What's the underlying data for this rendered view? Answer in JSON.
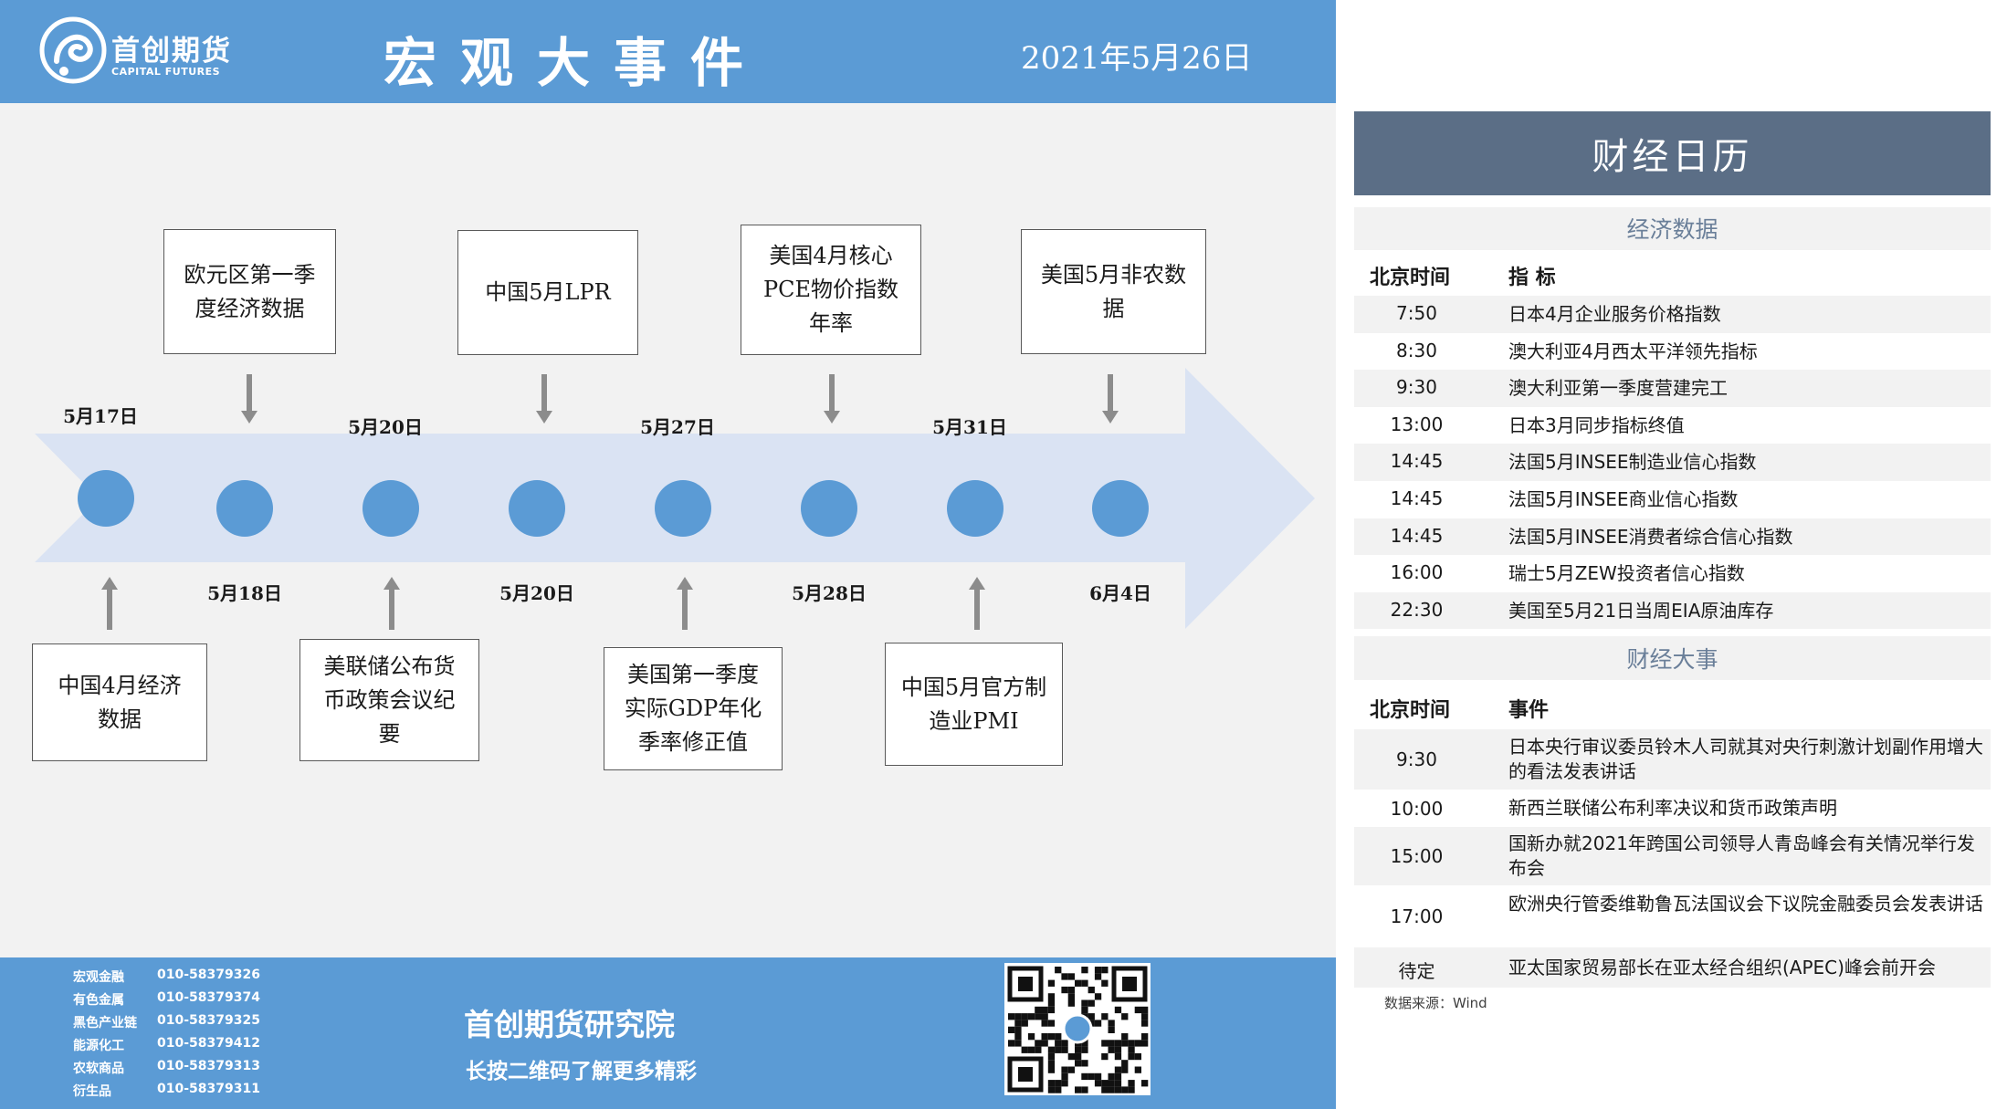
{
  "header": {
    "logo_cn": "首创期货",
    "logo_en": "CAPITAL FUTURES",
    "title": "宏观大事件",
    "date": "2021年5月26日"
  },
  "timeline": {
    "top_dates": [
      "5月17日",
      "5月20日",
      "5月27日",
      "5月31日"
    ],
    "bottom_dates": [
      "5月18日",
      "5月20日",
      "5月28日",
      "6月4日"
    ],
    "top_events": [
      {
        "lines": [
          "欧元区第一季",
          "度经济数据"
        ]
      },
      {
        "lines": [
          "中国5月LPR"
        ]
      },
      {
        "lines": [
          "美国4月核心",
          "PCE物价指数",
          "年率"
        ]
      },
      {
        "lines": [
          "美国5月非农数",
          "据"
        ]
      }
    ],
    "bottom_events": [
      {
        "lines": [
          "中国4月经济",
          "数据"
        ]
      },
      {
        "lines": [
          "美联储公布货",
          "币政策会议纪",
          "要"
        ]
      },
      {
        "lines": [
          "美国第一季度",
          "实际GDP年化",
          "季率修正值"
        ]
      },
      {
        "lines": [
          "中国5月官方制",
          "造业PMI"
        ]
      }
    ]
  },
  "footer": {
    "contacts": [
      {
        "dept": "宏观金融",
        "phone": "010-58379326"
      },
      {
        "dept": "有色金属",
        "phone": "010-58379374"
      },
      {
        "dept": "黑色产业链",
        "phone": "010-58379325"
      },
      {
        "dept": "能源化工",
        "phone": "010-58379412"
      },
      {
        "dept": "农软商品",
        "phone": "010-58379313"
      },
      {
        "dept": "衍生品",
        "phone": "010-58379311"
      }
    ],
    "institute": "首创期货研究院",
    "slogan": "长按二维码了解更多精彩"
  },
  "calendar": {
    "title": "财经日历",
    "economic": {
      "section_title": "经济数据",
      "col_time": "北京时间",
      "col_item": "指  标",
      "rows": [
        {
          "time": "7:50",
          "text": "日本4月企业服务价格指数"
        },
        {
          "time": "8:30",
          "text": "澳大利亚4月西太平洋领先指标"
        },
        {
          "time": "9:30",
          "text": "澳大利亚第一季度营建完工"
        },
        {
          "time": "13:00",
          "text": "日本3月同步指标终值"
        },
        {
          "time": "14:45",
          "text": "法国5月INSEE制造业信心指数"
        },
        {
          "time": "14:45",
          "text": "法国5月INSEE商业信心指数"
        },
        {
          "time": "14:45",
          "text": "法国5月INSEE消费者综合信心指数"
        },
        {
          "time": "16:00",
          "text": "瑞士5月ZEW投资者信心指数"
        },
        {
          "time": "22:30",
          "text": "美国至5月21日当周EIA原油库存"
        }
      ]
    },
    "events": {
      "section_title": "财经大事",
      "col_time": "北京时间",
      "col_item": "事件",
      "rows": [
        {
          "time": "9:30",
          "text": "日本央行审议委员铃木人司就其对央行刺激计划副作用增大的看法发表讲话"
        },
        {
          "time": "10:00",
          "text": "新西兰联储公布利率决议和货币政策声明"
        },
        {
          "time": "15:00",
          "text": "国新办就2021年跨国公司领导人青岛峰会有关情况举行发布会"
        },
        {
          "time": "17:00",
          "text": "欧洲央行管委维勒鲁瓦法国议会下议院金融委员会发表讲话"
        },
        {
          "time": "待定",
          "text": "亚太国家贸易部长在亚太经合组织(APEC)峰会前开会"
        }
      ]
    },
    "source": "数据来源：Wind"
  },
  "colors": {
    "header_blue": "#5b9bd5",
    "calendar_header": "#5b6e86",
    "circle_blue": "#5b9bd5",
    "arrow_fill": "#dae3f3"
  }
}
